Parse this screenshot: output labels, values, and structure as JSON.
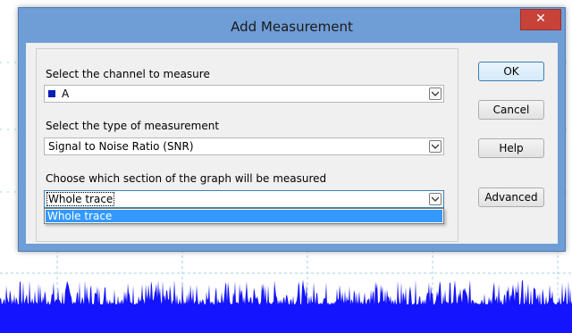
{
  "dialog": {
    "title": "Add Measurement",
    "close_label": "✕"
  },
  "channel": {
    "label": "Select the channel to measure",
    "value": "A",
    "color": "#0a1fb5"
  },
  "measurement_type": {
    "label": "Select the type of measurement",
    "value": "Signal to Noise Ratio (SNR)"
  },
  "section": {
    "label": "Choose which section of the graph will be measured",
    "value": "Whole trace",
    "options": [
      "Whole trace"
    ]
  },
  "buttons": {
    "ok": "OK",
    "cancel": "Cancel",
    "help": "Help",
    "advanced": "Advanced"
  },
  "colors": {
    "trace": "#1414ff",
    "grid": "#9fd6df",
    "titlebar": "#6f9dd6",
    "selection": "#3399ff"
  }
}
